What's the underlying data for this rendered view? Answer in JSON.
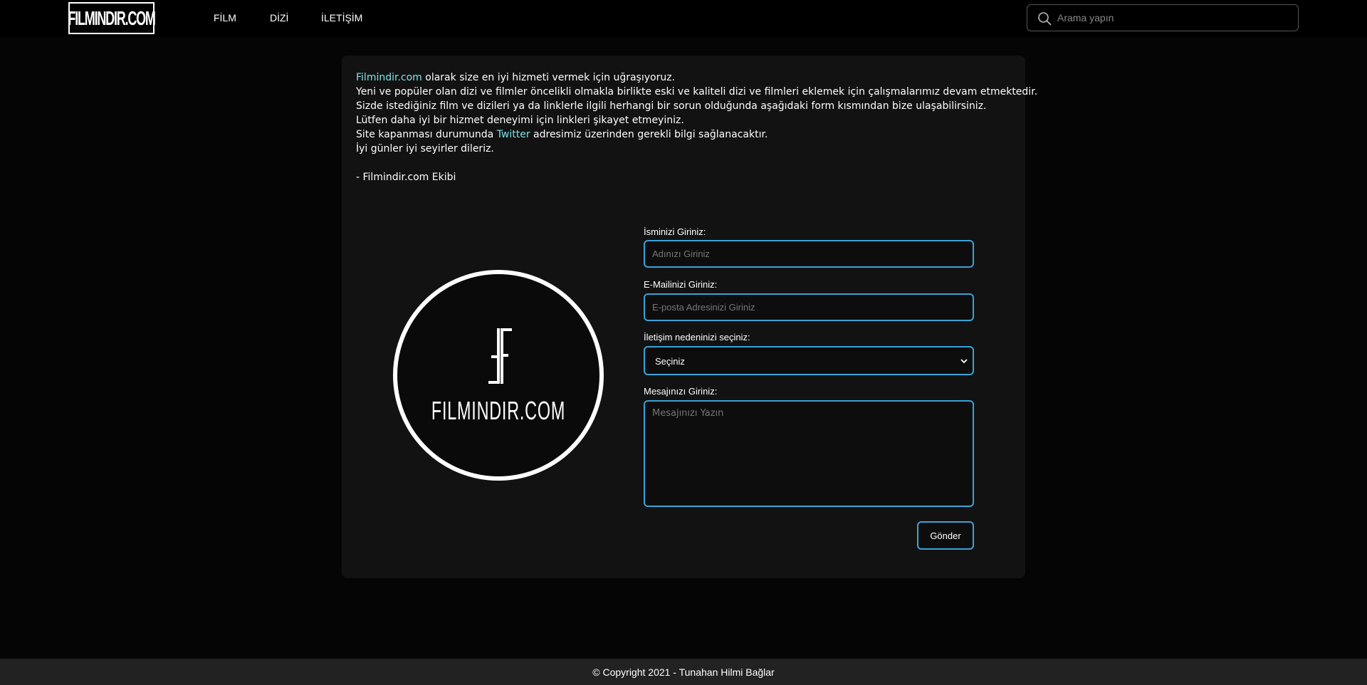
{
  "header": {
    "logo_text": "FILMINDIR.COM",
    "nav": [
      {
        "label": "FİLM"
      },
      {
        "label": "DİZİ"
      },
      {
        "label": "İLETİŞİM"
      }
    ],
    "search": {
      "placeholder": "Arama yapın",
      "icon": "search-icon"
    }
  },
  "intro": {
    "line1_link": "Filmindir.com",
    "line1_rest": " olarak size en iyi hizmeti vermek için uğraşıyoruz.",
    "line2": "Yeni ve popüler olan dizi ve filmler öncelikli olmakla birlikte eski ve kaliteli dizi ve filmleri eklemek için çalışmalarımız devam etmektedir.",
    "line3": "Sizde istediğiniz film ve dizileri ya da linklerle ilgili herhangi bir sorun olduğunda aşağıdaki form kısmından bize ulaşabilirsiniz.",
    "line4": "Lütfen daha iyi bir hizmet deneyimi için linkleri şikayet etmeyiniz.",
    "line5_pre": "Site kapanması durumunda ",
    "line5_link": "Twitter",
    "line5_post": " adresimiz üzerinden gerekli bilgi sağlanacaktır.",
    "line6": "İyi günler iyi seyirler dileriz.",
    "signature": "- Filmindir.com Ekibi"
  },
  "brand": {
    "circle_text": "FILMINDIR.COM",
    "link_color": "#7fe3ea",
    "accent": "#3aa3d8"
  },
  "form": {
    "name_label": "İsminizi Giriniz:",
    "name_placeholder": "Adınızı Giriniz",
    "email_label": "E-Mailinizi Giriniz:",
    "email_placeholder": "E-posta Adresinizi Giriniz",
    "reason_label": "İletişim nedeninizi seçiniz:",
    "reason_selected": "Seçiniz",
    "message_label": "Mesajınızı Giriniz:",
    "message_placeholder": "Mesajınızı Yazın",
    "submit_label": "Gönder"
  },
  "footer": {
    "copyright": "© Copyright 2021 - Tunahan Hilmi Bağlar"
  }
}
